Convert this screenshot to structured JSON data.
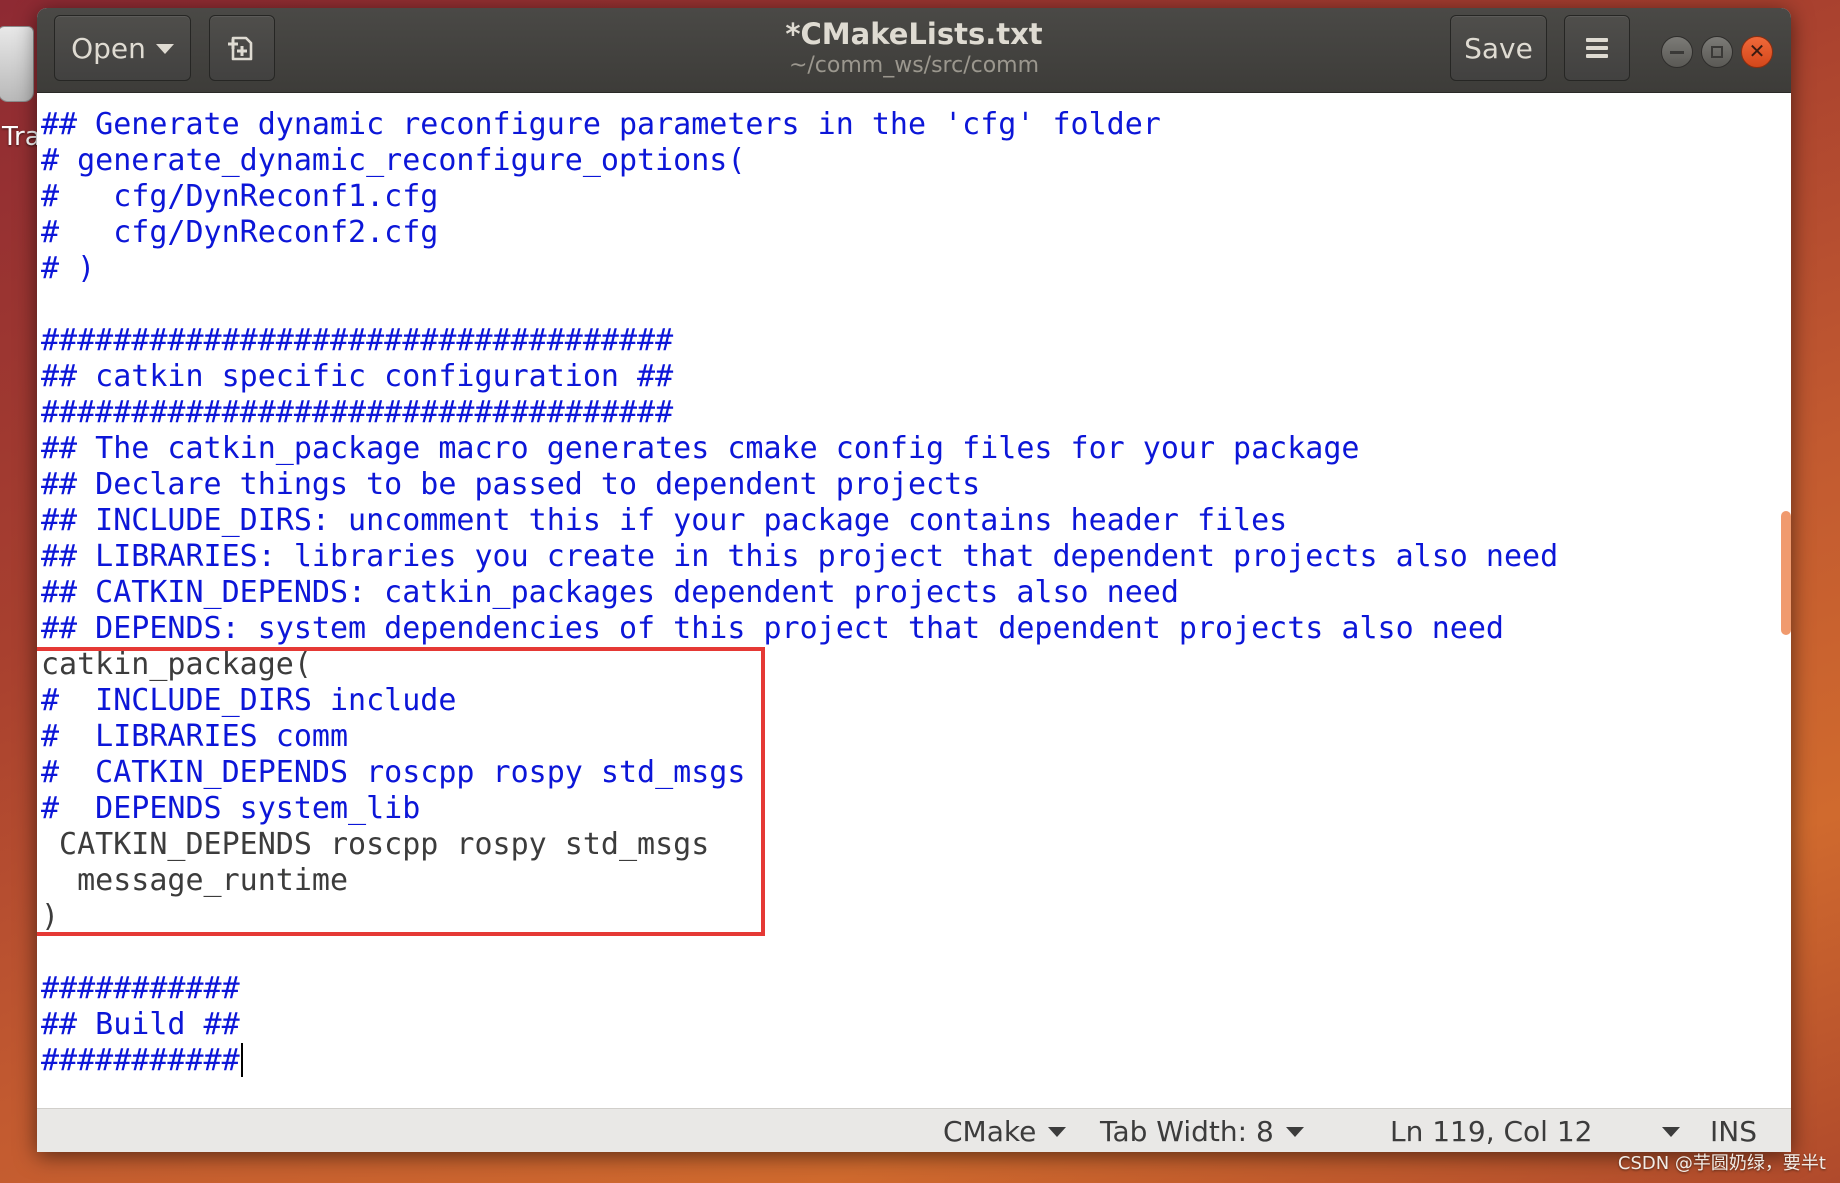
{
  "desktop": {
    "trash_label": "Tra"
  },
  "window": {
    "title": "*CMakeLists.txt",
    "subtitle": "~/comm_ws/src/comm"
  },
  "toolbar": {
    "open_label": "Open",
    "new_tab_icon": "new-document-icon",
    "save_label": "Save",
    "menu_icon": "hamburger-icon"
  },
  "editor": {
    "lines": [
      "## Generate dynamic reconfigure parameters in the 'cfg' folder",
      "# generate_dynamic_reconfigure_options(",
      "#   cfg/DynReconf1.cfg",
      "#   cfg/DynReconf2.cfg",
      "# )",
      "",
      "###################################",
      "## catkin specific configuration ##",
      "###################################",
      "## The catkin_package macro generates cmake config files for your package",
      "## Declare things to be passed to dependent projects",
      "## INCLUDE_DIRS: uncomment this if your package contains header files",
      "## LIBRARIES: libraries you create in this project that dependent projects also need",
      "## CATKIN_DEPENDS: catkin_packages dependent projects also need",
      "## DEPENDS: system dependencies of this project that dependent projects also need",
      "catkin_package(",
      "#  INCLUDE_DIRS include",
      "#  LIBRARIES comm",
      "#  CATKIN_DEPENDS roscpp rospy std_msgs",
      "#  DEPENDS system_lib",
      " CATKIN_DEPENDS roscpp rospy std_msgs",
      "  message_runtime",
      ")",
      "",
      "###########",
      "## Build ##",
      "###########"
    ],
    "comment_color": "#0c16d8",
    "text_color": "#3c3c3c",
    "highlight_color": "#e53935"
  },
  "statusbar": {
    "language": "CMake",
    "tab_width": "Tab Width: 8",
    "position": "Ln 119, Col 12",
    "mode": "INS"
  },
  "watermark": "CSDN @芋圆奶绿，要半t"
}
